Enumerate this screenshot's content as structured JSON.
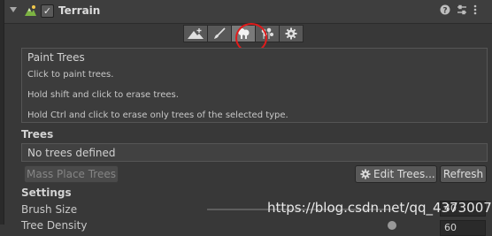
{
  "header": {
    "title": "Terrain",
    "enabled_check": "✓",
    "icons": [
      "foldout-arrow-icon",
      "terrain-icon",
      "help-icon",
      "preset-icon",
      "context-menu-icon"
    ]
  },
  "toolbar": {
    "tools": [
      {
        "name": "raise-terrain",
        "icon": "mountain-plus-icon"
      },
      {
        "name": "paint-texture",
        "icon": "brush-icon"
      },
      {
        "name": "paint-trees",
        "icon": "trees-icon",
        "selected": true
      },
      {
        "name": "paint-details",
        "icon": "flowers-icon"
      },
      {
        "name": "settings",
        "icon": "gear-icon"
      }
    ],
    "highlight_color": "#e01b1b"
  },
  "help": {
    "title": "Paint Trees",
    "line1": "Click to paint trees.",
    "line2": "Hold shift and click to erase trees.",
    "line3": "Hold Ctrl and click to erase only trees of the selected type."
  },
  "trees": {
    "heading": "Trees",
    "empty_text": "No trees defined",
    "mass_place_label": "Mass Place Trees",
    "edit_trees_label": "Edit Trees...",
    "refresh_label": "Refresh"
  },
  "settings": {
    "heading": "Settings",
    "brush_size_label": "Brush Size",
    "brush_size_value": "40",
    "tree_density_label": "Tree Density",
    "tree_density_value": "60"
  },
  "watermark": "https://blog.csdn.net/qq_43730079"
}
